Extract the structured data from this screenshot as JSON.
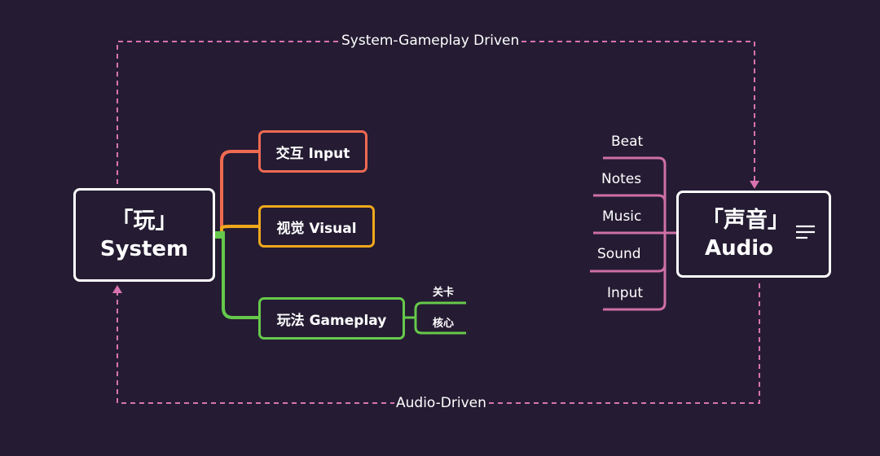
{
  "flows": {
    "top_label": "System-Gameplay Driven",
    "bottom_label": "Audio-Driven"
  },
  "system": {
    "title_cn": "「玩」",
    "title_en": "System",
    "children": [
      {
        "label": "交互 Input",
        "color": "#ef6a52"
      },
      {
        "label": "视觉 Visual",
        "color": "#f0a81c"
      },
      {
        "label": "玩法 Gameplay",
        "color": "#66c94b",
        "leaves": [
          "关卡",
          "核心"
        ]
      }
    ]
  },
  "audio": {
    "title_cn": "「声音」",
    "title_en": "Audio",
    "icon": "menu-lines-icon",
    "leaves": [
      "Beat",
      "Notes",
      "Music",
      "Sound",
      "Input"
    ],
    "color": "#cf6fa6"
  },
  "colors": {
    "background": "#251c33",
    "dashed": "#d873b0",
    "node_border": "#ffffff"
  }
}
